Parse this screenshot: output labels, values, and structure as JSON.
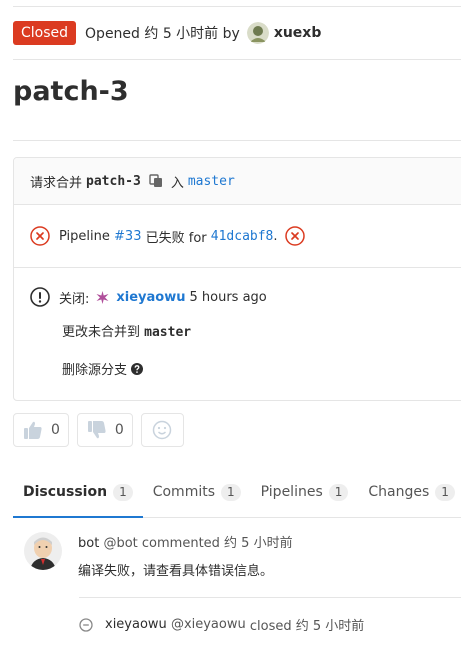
{
  "header": {
    "status_badge": "Closed",
    "opened_text": "Opened 约 5 小时前 by",
    "author": "xuexb"
  },
  "title": "patch-3",
  "merge_widget": {
    "request_label": "请求合并",
    "source_branch": "patch-3",
    "into_label": "入",
    "target_branch": "master",
    "pipeline": {
      "prefix": "Pipeline",
      "id": "#33",
      "status_text": "已失败 for",
      "commit": "41dcabf8",
      "suffix": "."
    },
    "closed": {
      "label": "关闭:",
      "user": "xieyaowu",
      "time": "5 hours ago",
      "not_merged_text": "更改未合并到",
      "not_merged_branch": "master",
      "remove_source_label": "删除源分支"
    }
  },
  "awards": {
    "thumbsup_count": "0",
    "thumbsdown_count": "0"
  },
  "tabs": [
    {
      "label": "Discussion",
      "count": "1"
    },
    {
      "label": "Commits",
      "count": "1"
    },
    {
      "label": "Pipelines",
      "count": "1"
    },
    {
      "label": "Changes",
      "count": "1"
    }
  ],
  "notes": {
    "comment": {
      "author_name": "bot",
      "author_handle": "@bot",
      "action": "commented 约 5 小时前",
      "text": "编译失败，请查看具体错误信息。"
    },
    "system": {
      "author_name": "xieyaowu",
      "author_handle": "@xieyaowu",
      "action": "closed 约 5 小时前"
    }
  },
  "colors": {
    "badge_closed": "#db3b21",
    "link": "#1f78d1",
    "failed": "#db3b21"
  }
}
